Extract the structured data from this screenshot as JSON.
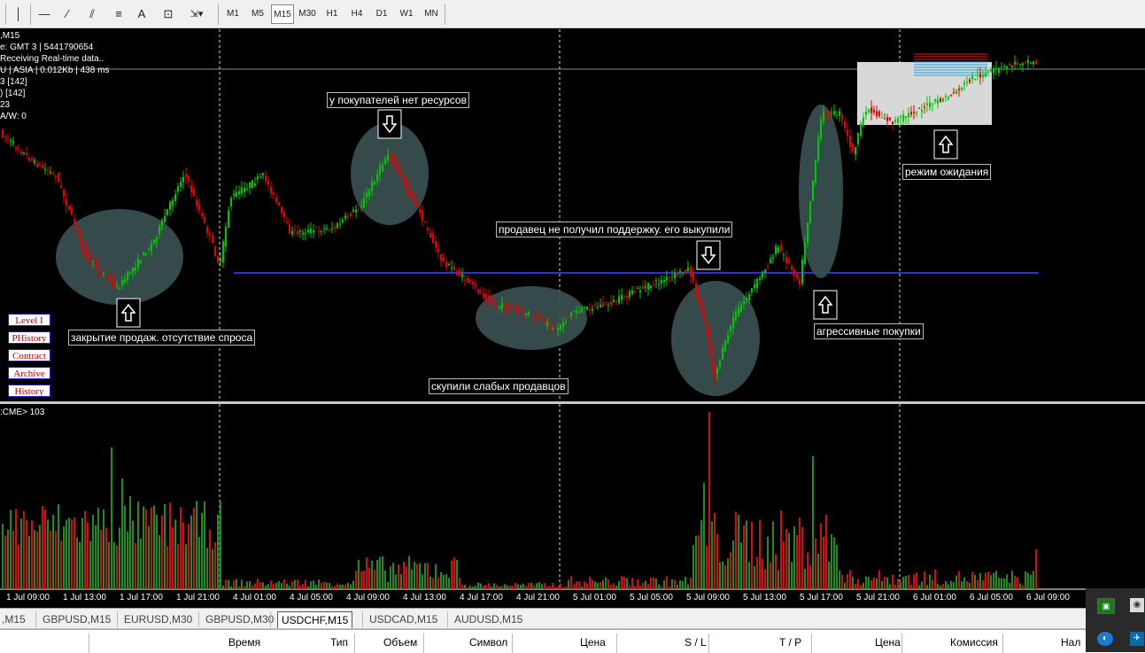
{
  "toolbar": {
    "timeframes": [
      "M1",
      "M5",
      "M15",
      "M30",
      "H1",
      "H4",
      "D1",
      "W1",
      "MN"
    ],
    "active_timeframe": "M15",
    "text_tool_label": "A"
  },
  "chart_info": {
    "line1": ",M15",
    "line2": "e: GMT 3 | 5441790654",
    "line3": "Receiving Real-time data..",
    "line4": " U | ASIA | 0.012Kb | 438 ms",
    "line5": "3  [142]",
    "line6": ")  [142]",
    "line7": "23",
    "line8": "A/W: 0"
  },
  "side_buttons": [
    "Level I",
    "PHistory",
    "Contract",
    "Archive",
    "History"
  ],
  "annotations": {
    "no_resources": "у покупателей нет ресурсов",
    "seller_no_support": "продавец не получил поддержку. его выкупили",
    "close_sales": "закрытие продаж. отсутствие спроса",
    "bought_weak": "скупили слабых продавцов",
    "aggressive": "агрессивные покупки",
    "waiting": "режим ожидания"
  },
  "volume_indicator": {
    "label": ":CME> 103"
  },
  "time_axis": [
    "1 Jul 09:00",
    "1 Jul 13:00",
    "1 Jul 17:00",
    "1 Jul 21:00",
    "4 Jul 01:00",
    "4 Jul 05:00",
    "4 Jul 09:00",
    "4 Jul 13:00",
    "4 Jul 17:00",
    "4 Jul 21:00",
    "5 Jul 01:00",
    "5 Jul 05:00",
    "5 Jul 09:00",
    "5 Jul 13:00",
    "5 Jul 17:00",
    "5 Jul 21:00",
    "6 Jul 01:00",
    "6 Jul 05:00",
    "6 Jul 09:00"
  ],
  "symbol_tabs": [
    ",M15",
    "GBPUSD,M15",
    "EURUSD,M30",
    "GBPUSD,M30",
    "USDCHF,M15",
    "USDCAD,M15",
    "AUDUSD,M15"
  ],
  "active_tab": "USDCHF,M15",
  "terminal_columns": [
    "Время",
    "Тип",
    "Объем",
    "Символ",
    "Цена",
    "S / L",
    "T / P",
    "Цена",
    "Комиссия",
    "Нал"
  ],
  "colors": {
    "bull": "#00c800",
    "bear": "#e60000",
    "level_line": "#3030d0",
    "ellipse": "#3a5050",
    "volume_bull": "#1e8c1e",
    "volume_bear": "#d01010"
  }
}
